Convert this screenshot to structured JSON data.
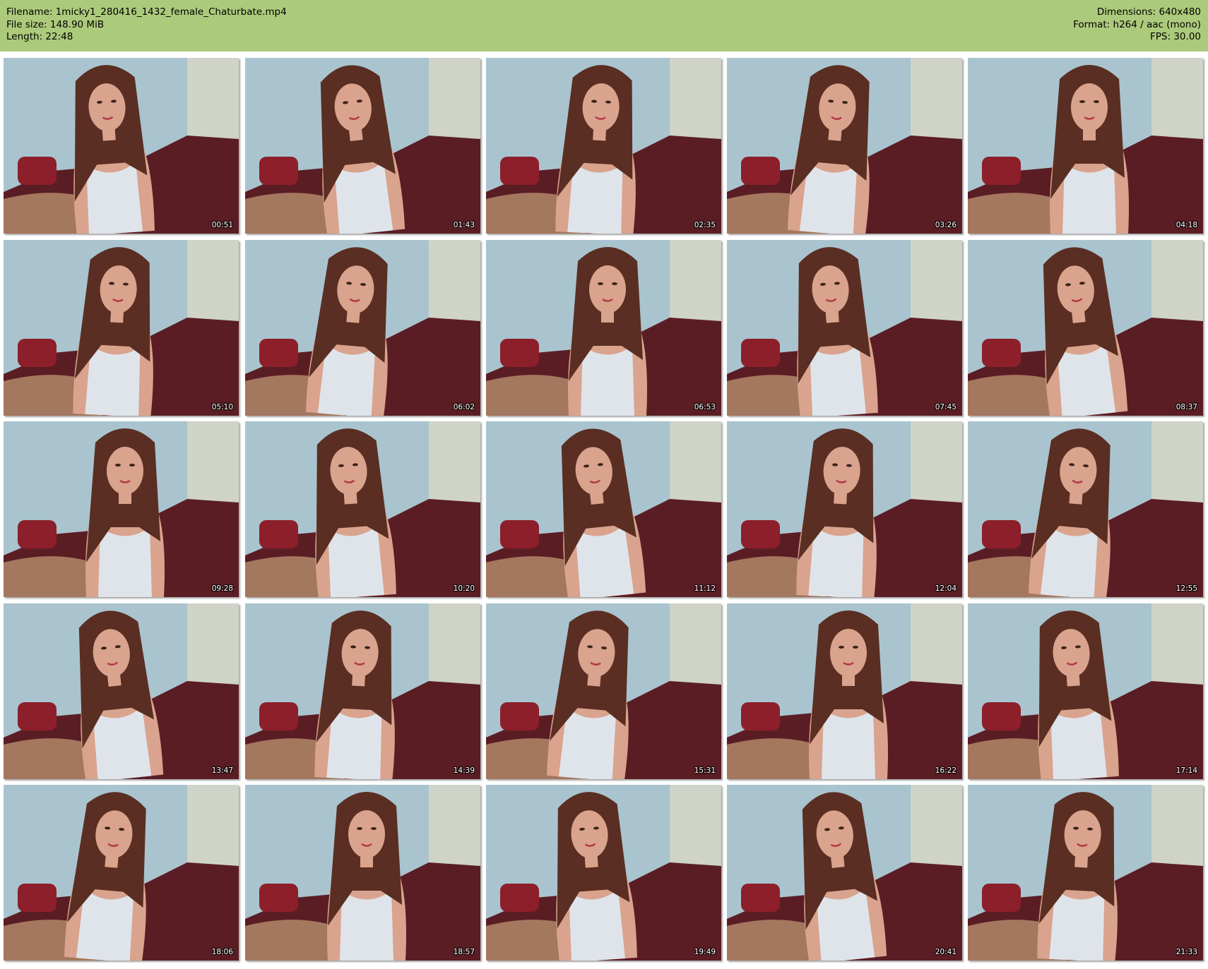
{
  "header": {
    "filename": "Filename: 1micky1_280416_1432_female_Chaturbate.mp4",
    "filesize": "File size: 148.90 MiB",
    "length": "Length: 22:48",
    "dimensions": "Dimensions: 640x480",
    "format": "Format: h264 / aac (mono)",
    "fps": "FPS: 30.00"
  },
  "colors": {
    "header_bg": "#acca7b",
    "wall": "#a9c4cf",
    "blanket": "#5b1d24",
    "top": "#dfe4ea",
    "hair": "#5a2e22",
    "skin": "#d9a38e"
  },
  "thumbnails": [
    {
      "time": "00:51"
    },
    {
      "time": "01:43"
    },
    {
      "time": "02:35"
    },
    {
      "time": "03:26"
    },
    {
      "time": "04:18"
    },
    {
      "time": "05:10"
    },
    {
      "time": "06:02"
    },
    {
      "time": "06:53"
    },
    {
      "time": "07:45"
    },
    {
      "time": "08:37"
    },
    {
      "time": "09:28"
    },
    {
      "time": "10:20"
    },
    {
      "time": "11:12"
    },
    {
      "time": "12:04"
    },
    {
      "time": "12:55"
    },
    {
      "time": "13:47"
    },
    {
      "time": "14:39"
    },
    {
      "time": "15:31"
    },
    {
      "time": "16:22"
    },
    {
      "time": "17:14"
    },
    {
      "time": "18:06"
    },
    {
      "time": "18:57"
    },
    {
      "time": "19:49"
    },
    {
      "time": "20:41"
    },
    {
      "time": "21:33"
    }
  ]
}
